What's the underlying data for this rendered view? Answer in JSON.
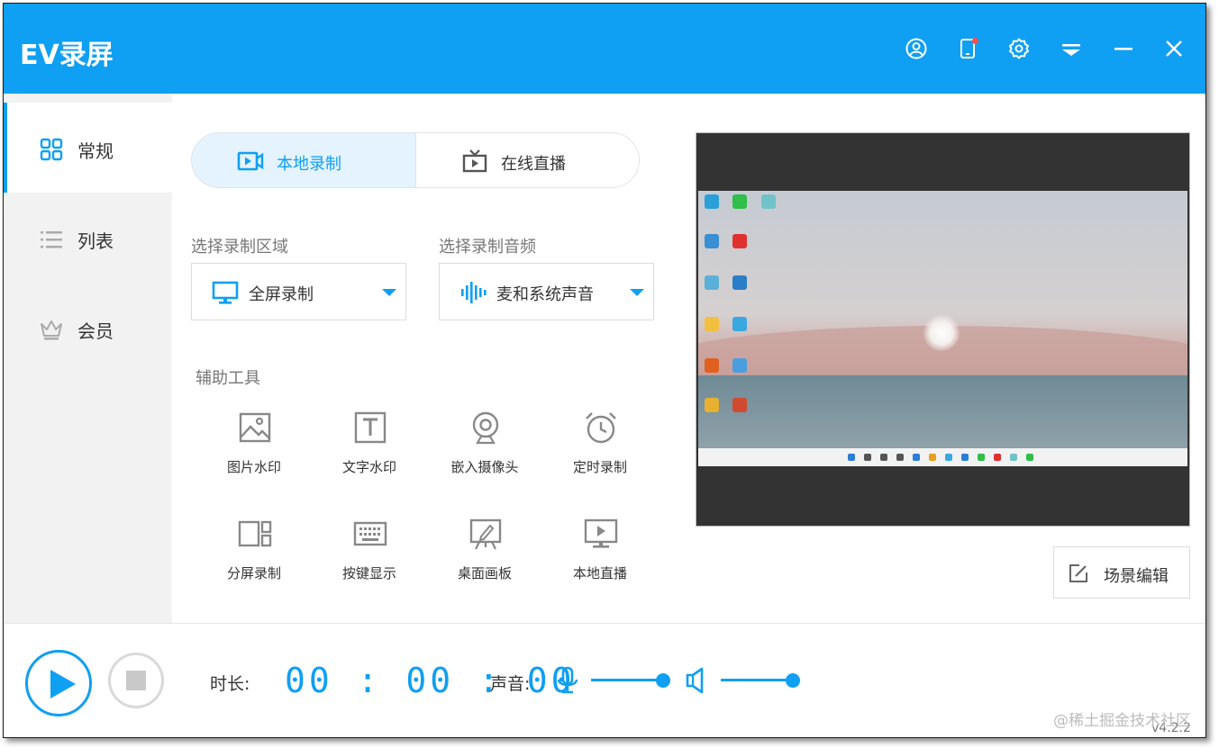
{
  "app": {
    "title": "EV录屏",
    "version": "v4.2.2",
    "accent": "#0f9ff3"
  },
  "titlebar": {
    "icons": [
      "user-icon",
      "phone-icon",
      "gear-icon",
      "menu-icon",
      "minimize-icon",
      "close-icon"
    ]
  },
  "sidebar": {
    "items": [
      {
        "label": "常规",
        "icon": "grid-icon",
        "active": true
      },
      {
        "label": "列表",
        "icon": "list-icon",
        "active": false
      },
      {
        "label": "会员",
        "icon": "crown-icon",
        "active": false
      }
    ]
  },
  "mode_tabs": [
    {
      "label": "本地录制",
      "icon": "video-icon",
      "active": true
    },
    {
      "label": "在线直播",
      "icon": "tv-icon",
      "active": false
    }
  ],
  "record_area": {
    "label": "选择录制区域",
    "value": "全屏录制"
  },
  "record_audio": {
    "label": "选择录制音频",
    "value": "麦和系统声音"
  },
  "tools": {
    "label": "辅助工具",
    "items": [
      {
        "label": "图片水印",
        "icon": "image-icon"
      },
      {
        "label": "文字水印",
        "icon": "text-icon"
      },
      {
        "label": "嵌入摄像头",
        "icon": "webcam-icon"
      },
      {
        "label": "定时录制",
        "icon": "alarm-clock-icon"
      },
      {
        "label": "分屏录制",
        "icon": "split-screen-icon"
      },
      {
        "label": "按键显示",
        "icon": "keyboard-icon"
      },
      {
        "label": "桌面画板",
        "icon": "easel-icon"
      },
      {
        "label": "本地直播",
        "icon": "monitor-play-icon"
      }
    ]
  },
  "scene_edit": {
    "label": "场景编辑"
  },
  "bottom": {
    "duration_label": "时长:",
    "timer": "00:00:00",
    "sound_label": "声音:",
    "mic_level": 1.0,
    "speaker_level": 1.0
  },
  "watermark": "@稀土掘金技术社区"
}
